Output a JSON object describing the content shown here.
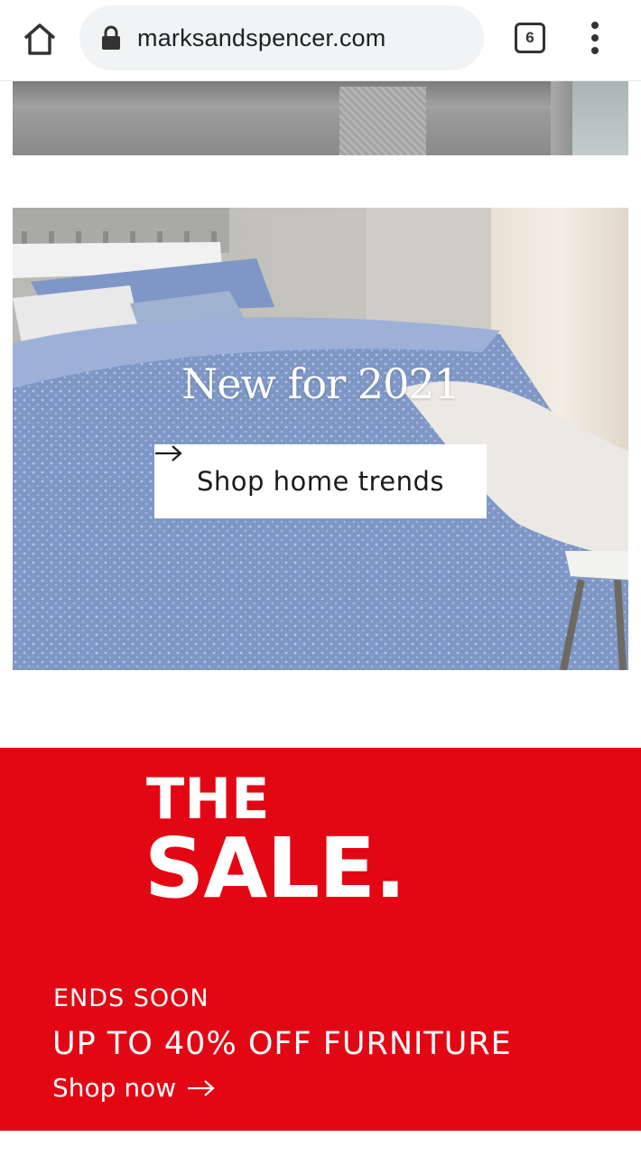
{
  "browser": {
    "url": "marksandspencer.com",
    "tab_count": "6",
    "icons": {
      "home": "home-icon",
      "lock": "lock-icon",
      "menu": "more-vert-icon"
    }
  },
  "hero": {
    "title": "New for 2021",
    "cta_label": "Shop home trends"
  },
  "sale": {
    "line1": "THE",
    "line2": "SALE.",
    "ends": "ENDS SOON",
    "offer": "UP TO 40% OFF FURNITURE",
    "cta": "Shop now",
    "color": "#e30613"
  }
}
